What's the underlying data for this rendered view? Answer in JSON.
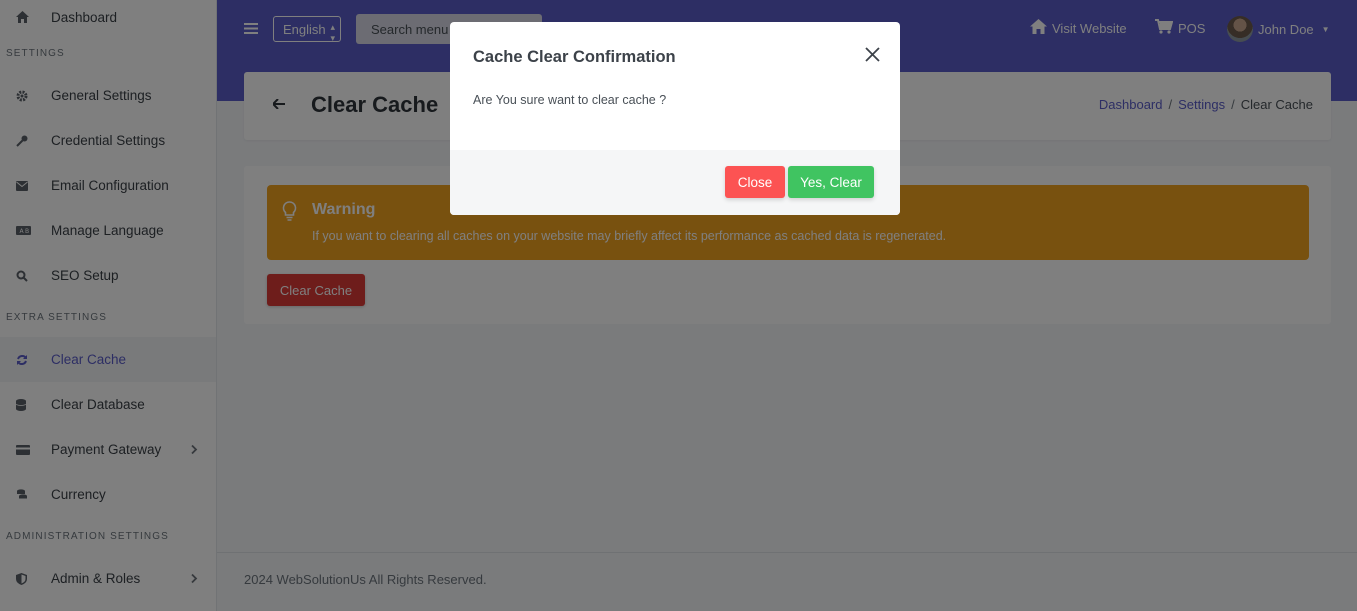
{
  "sidebar": {
    "dashboard": "Dashboard",
    "settings_heading": "SETTINGS",
    "settings_items": [
      "General Settings",
      "Credential Settings",
      "Email Configuration",
      "Manage Language",
      "SEO Setup"
    ],
    "extra_heading": "EXTRA SETTINGS",
    "extra_items": [
      "Clear Cache",
      "Clear Database",
      "Payment Gateway",
      "Currency"
    ],
    "admin_heading": "ADMINISTRATION SETTINGS",
    "admin_items": [
      "Admin & Roles"
    ]
  },
  "header": {
    "language": "English",
    "search_placeholder": "Search menu",
    "visit_website": "Visit Website",
    "pos": "POS",
    "user_name": "John Doe"
  },
  "page": {
    "title": "Clear Cache",
    "breadcrumb": [
      "Dashboard",
      "Settings",
      "Clear Cache"
    ]
  },
  "warning": {
    "title": "Warning",
    "text": "If you want to clearing all caches on your website may briefly affect its performance as cached data is regenerated."
  },
  "clear_button": "Clear Cache",
  "footer": "2024 WebSolutionUs All Rights Reserved.",
  "modal": {
    "title": "Cache Clear Confirmation",
    "body": "Are You sure want to clear cache ?",
    "close_label": "Close",
    "confirm_label": "Yes, Clear"
  },
  "colors": {
    "primary": "#5a5dc9",
    "warning": "#f0a21f",
    "danger": "#dc3a37",
    "success": "#40c461"
  }
}
